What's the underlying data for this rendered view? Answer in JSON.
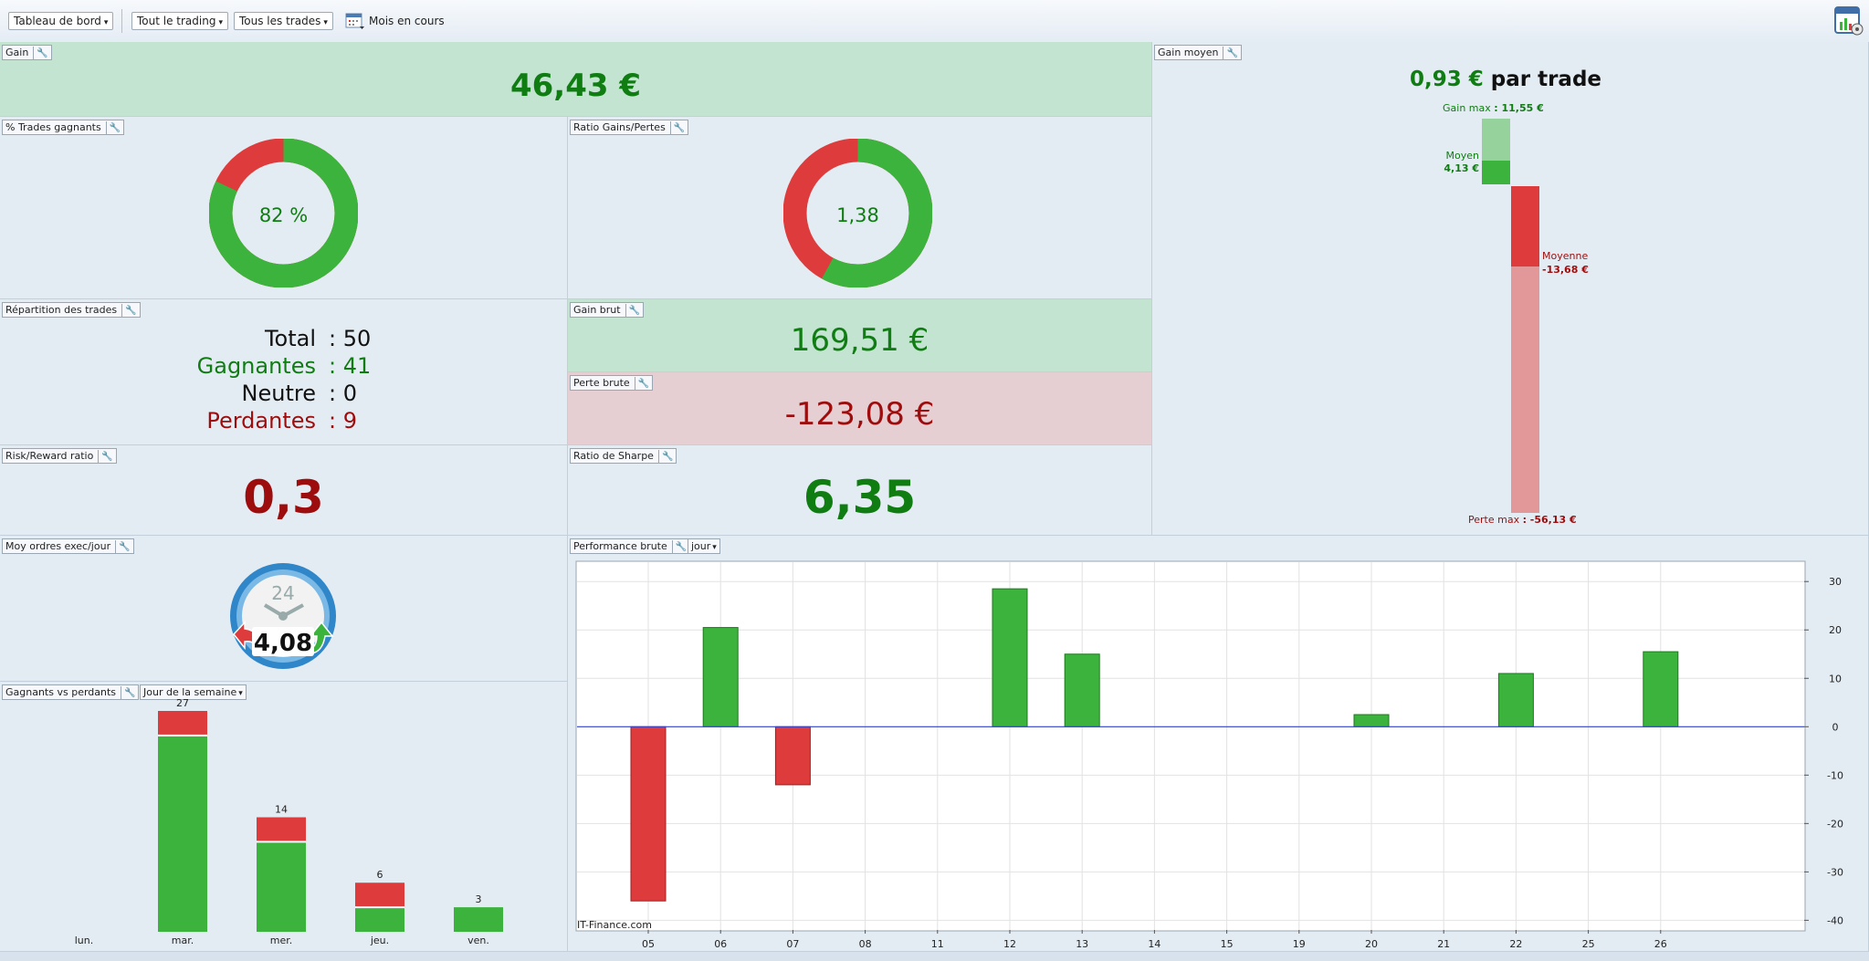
{
  "toolbar": {
    "dashboard_select": "Tableau de bord",
    "trading_select": "Tout le trading",
    "trades_select": "Tous les trades",
    "period_label": "Mois en cours"
  },
  "colors": {
    "gain": "#0f7d12",
    "loss": "#9e0d0d",
    "bar_green": "#3cb33c",
    "bar_red": "#de3c3c"
  },
  "gain": {
    "title": "Gain",
    "value": "46,43 €"
  },
  "win_rate": {
    "title": "% Trades gagnants",
    "label": "82 %",
    "percent": 82
  },
  "profit_ratio": {
    "title": "Ratio Gains/Pertes",
    "label": "1,38",
    "value": 1.38
  },
  "distribution": {
    "title": "Répartition des trades",
    "rows": [
      {
        "label": "Total",
        "value": ": 50"
      },
      {
        "label": "Gagnantes",
        "value": ": 41"
      },
      {
        "label": "Neutre",
        "value": ": 0"
      },
      {
        "label": "Perdantes",
        "value": ": 9"
      }
    ]
  },
  "gross_gain": {
    "title": "Gain brut",
    "value": "169,51 €"
  },
  "gross_loss": {
    "title": "Perte brute",
    "value": "-123,08 €"
  },
  "risk_reward": {
    "title": "Risk/Reward ratio",
    "value": "0,3"
  },
  "sharpe": {
    "title": "Ratio de Sharpe",
    "value": "6,35"
  },
  "avg_gain": {
    "title": "Gain moyen",
    "value": "0,93 €",
    "suffix": "par trade",
    "max_gain_label": "Gain max",
    "max_gain_value": ": 11,55 €",
    "avg_win_label": "Moyen",
    "avg_win_value": "4,13 €",
    "avg_loss_label": "Moyenne",
    "avg_loss_value": "-13,68 €",
    "max_loss_label": "Perte max",
    "max_loss_value": ": -56,13 €",
    "max_gain": 11.55,
    "avg_win": 4.13,
    "avg_loss": -13.68,
    "max_loss": -56.13
  },
  "orders": {
    "title": "Moy ordres exec/jour",
    "value": "4,08",
    "clock_label": "24"
  },
  "winloss": {
    "title": "Gagnants vs perdants",
    "filter": "Jour de la semaine",
    "days": [
      {
        "label": "lun.",
        "total": "",
        "wins": 0,
        "losses": 0
      },
      {
        "label": "mar.",
        "total": "27",
        "wins": 24,
        "losses": 3
      },
      {
        "label": "mer.",
        "total": "14",
        "wins": 11,
        "losses": 3
      },
      {
        "label": "jeu.",
        "total": "6",
        "wins": 3,
        "losses": 3
      },
      {
        "label": "ven.",
        "total": "3",
        "wins": 3,
        "losses": 0
      }
    ]
  },
  "performance": {
    "title": "Performance brute",
    "period": "jour",
    "watermark": "IT-Finance.com"
  },
  "chart_data": {
    "type": "bar",
    "title": "Performance brute",
    "categories": [
      "05",
      "06",
      "07",
      "08",
      "11",
      "12",
      "13",
      "14",
      "15",
      "19",
      "20",
      "21",
      "22",
      "25",
      "26"
    ],
    "values": [
      -36,
      20.5,
      -12,
      0,
      0,
      28.5,
      15,
      0,
      0,
      0,
      2.5,
      0,
      11,
      0,
      15.5
    ],
    "ylim": [
      -42,
      34
    ],
    "yticks": [
      "30",
      "20",
      "10",
      "0",
      "-10",
      "-20",
      "-30",
      "-40"
    ],
    "ytick_values": [
      30,
      20,
      10,
      0,
      -10,
      -20,
      -30,
      -40
    ],
    "grid": true
  }
}
